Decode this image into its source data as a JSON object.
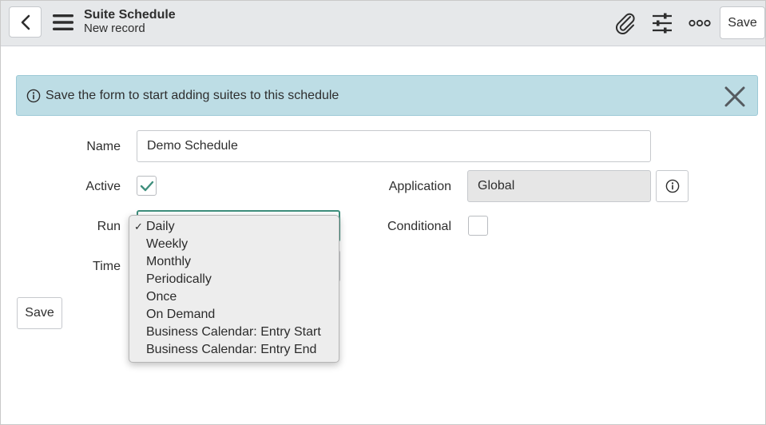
{
  "header": {
    "title": "Suite Schedule",
    "subtitle": "New record",
    "save_label": "Save",
    "icons": [
      "back-icon",
      "menu-icon",
      "paperclip-icon",
      "sliders-icon",
      "more-icon"
    ]
  },
  "banner": {
    "message": "Save the form to start adding suites to this schedule",
    "color": "#bddde5"
  },
  "form": {
    "name_label": "Name",
    "name_value": "Demo Schedule",
    "active_label": "Active",
    "active_checked": true,
    "application_label": "Application",
    "application_value": "Global",
    "run_label": "Run",
    "conditional_label": "Conditional",
    "conditional_checked": false,
    "time_label": "Time",
    "save_label": "Save"
  },
  "run_dropdown": {
    "selected": "Daily",
    "options": [
      "Daily",
      "Weekly",
      "Monthly",
      "Periodically",
      "Once",
      "On Demand",
      "Business Calendar: Entry Start",
      "Business Calendar: Entry End"
    ]
  },
  "colors": {
    "accent": "#3f8f7d",
    "header_bg": "#e6e8ea"
  }
}
